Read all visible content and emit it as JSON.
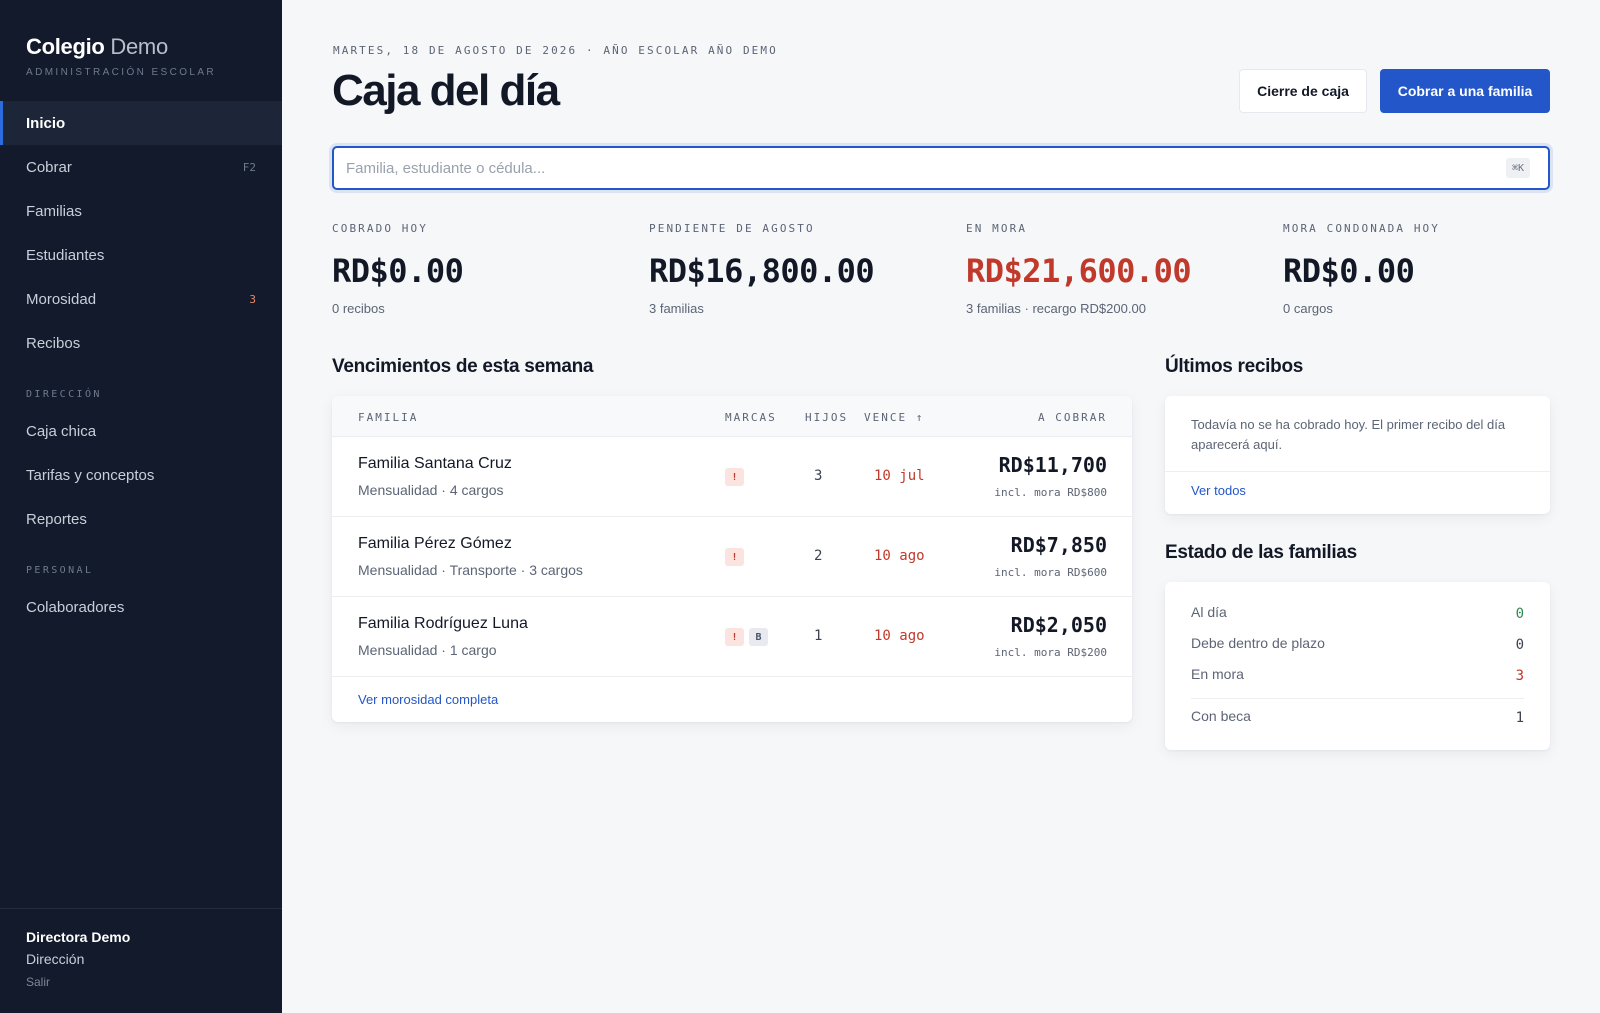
{
  "sidebar": {
    "brand_bold": "Colegio",
    "brand_light": "Demo",
    "brand_sub": "ADMINISTRACIÓN ESCOLAR",
    "items": [
      {
        "label": "Inicio"
      },
      {
        "label": "Cobrar",
        "shortcut": "F2"
      },
      {
        "label": "Familias"
      },
      {
        "label": "Estudiantes"
      },
      {
        "label": "Morosidad",
        "badge": "3"
      },
      {
        "label": "Recibos"
      }
    ],
    "section_direccion": "DIRECCIÓN",
    "direccion_items": [
      {
        "label": "Caja chica"
      },
      {
        "label": "Tarifas y conceptos"
      },
      {
        "label": "Reportes"
      }
    ],
    "section_personal": "PERSONAL",
    "personal_items": [
      {
        "label": "Colaboradores"
      }
    ],
    "user": {
      "name": "Directora Demo",
      "role": "Dirección",
      "logout": "Salir"
    }
  },
  "header": {
    "date_line": "MARTES, 18 DE AGOSTO DE 2026 · AÑO ESCOLAR AÑO DEMO",
    "title": "Caja del día",
    "close_button": "Cierre de caja",
    "charge_button": "Cobrar a una familia"
  },
  "search": {
    "placeholder": "Familia, estudiante o cédula...",
    "value": "",
    "shortcut": "⌘K"
  },
  "stats": [
    {
      "label": "COBRADO HOY",
      "value": "RD$0.00",
      "sub": "0 recibos"
    },
    {
      "label": "PENDIENTE DE AGOSTO",
      "value": "RD$16,800.00",
      "sub": "3 familias"
    },
    {
      "label": "EN MORA",
      "value": "RD$21,600.00",
      "sub": "3 familias · recargo RD$200.00"
    },
    {
      "label": "MORA CONDONADA HOY",
      "value": "RD$0.00",
      "sub": "0 cargos"
    }
  ],
  "vencimientos": {
    "title": "Vencimientos de esta semana",
    "headers": {
      "familia": "FAMILIA",
      "marcas": "MARCAS",
      "hijos": "HIJOS",
      "vence": "VENCE ↑",
      "a_cobrar": "A COBRAR"
    },
    "rows": [
      {
        "name": "Familia Santana Cruz",
        "sub": "Mensualidad · 4 cargos",
        "marks": [
          "!"
        ],
        "hijos": "3",
        "vence": "10 jul",
        "amount": "RD$11,700",
        "amount_sub": "incl. mora RD$800"
      },
      {
        "name": "Familia Pérez Gómez",
        "sub": "Mensualidad · Transporte · 3 cargos",
        "marks": [
          "!"
        ],
        "hijos": "2",
        "vence": "10 ago",
        "amount": "RD$7,850",
        "amount_sub": "incl. mora RD$600"
      },
      {
        "name": "Familia Rodríguez Luna",
        "sub": "Mensualidad · 1 cargo",
        "marks": [
          "!",
          "B"
        ],
        "hijos": "1",
        "vence": "10 ago",
        "amount": "RD$2,050",
        "amount_sub": "incl. mora RD$200"
      }
    ],
    "link": "Ver morosidad completa"
  },
  "recibos": {
    "title": "Últimos recibos",
    "message": "Todavía no se ha cobrado hoy. El primer recibo del día aparecerá aquí.",
    "link": "Ver todos"
  },
  "estado": {
    "title": "Estado de las familias",
    "rows": [
      {
        "label": "Al día",
        "value": "0",
        "color": "#2e8b57"
      },
      {
        "label": "Debe dentro de plazo",
        "value": "0",
        "color": "#3b4252"
      },
      {
        "label": "En mora",
        "value": "3",
        "color": "#c0392b"
      },
      {
        "label": "Con beca",
        "value": "1",
        "color": "#3b4252"
      }
    ]
  },
  "colors": {
    "sidebar_bg": "#121a2b",
    "accent": "#2356c8",
    "danger": "#c0392b",
    "success": "#2e8b57"
  }
}
